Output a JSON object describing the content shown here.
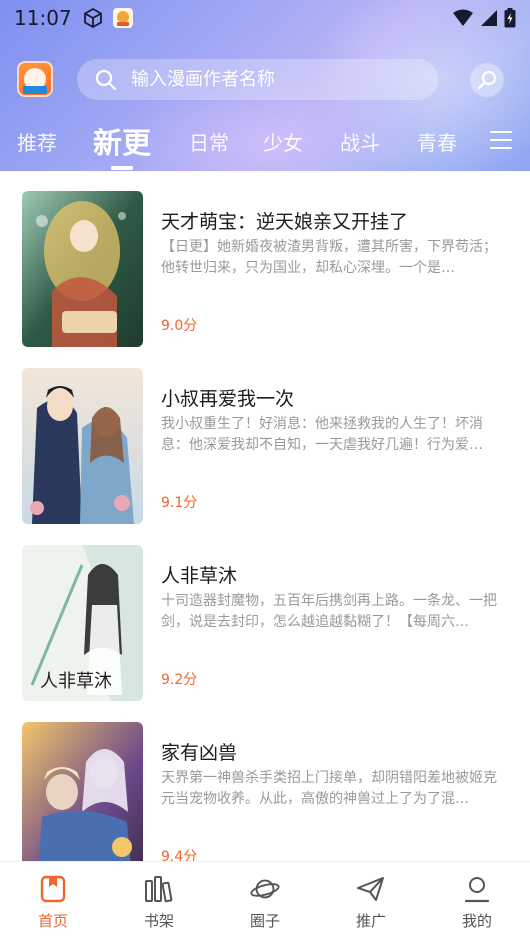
{
  "status_bar": {
    "time": "11:07"
  },
  "search": {
    "placeholder": "输入漫画作者名称"
  },
  "tabs": [
    {
      "label": "推荐",
      "active": false
    },
    {
      "label": "新更",
      "active": true
    },
    {
      "label": "日常",
      "active": false
    },
    {
      "label": "少女",
      "active": false
    },
    {
      "label": "战斗",
      "active": false
    },
    {
      "label": "青春",
      "active": false
    }
  ],
  "comics": [
    {
      "title": "天才萌宝：逆天娘亲又开挂了",
      "description": "【日更】她新婚夜被渣男背叛，遭其所害，下界苟活；他转世归来，只为国业，却私心深埋。一个是…",
      "rating": "9.0分",
      "cover_palette": [
        "#2f5a46",
        "#e6c46a",
        "#9fcbb5",
        "#c2573e"
      ]
    },
    {
      "title": "小叔再爱我一次",
      "description": "我小叔重生了！好消息：他来拯救我的人生了！坏消息：他深爱我却不自知，一天虐我好几遍！行为爱…",
      "rating": "9.1分",
      "cover_palette": [
        "#2b3a5c",
        "#d9c6a8",
        "#7ea7c9",
        "#f2e6d8"
      ]
    },
    {
      "title": "人非草沐",
      "description": "十司造器封魔物，五百年后携剑再上路。一条龙、一把剑，说是去封印，怎么越追越黏糊了！【每周六…",
      "rating": "9.2分",
      "cover_palette": [
        "#eef3ee",
        "#3c3c3c",
        "#7fb89a",
        "#d7e6de"
      ]
    },
    {
      "title": "家有凶兽",
      "description": "天界第一神兽杀手类招上门接单，却阴错阳差地被姬克元当宠物收养。从此，高傲的神兽过上了为了混…",
      "rating": "9.4分",
      "cover_palette": [
        "#3b2b4a",
        "#e8d4c2",
        "#6d4a8a",
        "#f3c66b"
      ]
    }
  ],
  "bottom_nav": [
    {
      "label": "首页",
      "icon": "home-book-icon",
      "active": true
    },
    {
      "label": "书架",
      "icon": "bookshelf-icon",
      "active": false
    },
    {
      "label": "圈子",
      "icon": "planet-icon",
      "active": false
    },
    {
      "label": "推广",
      "icon": "paper-plane-icon",
      "active": false
    },
    {
      "label": "我的",
      "icon": "user-icon",
      "active": false
    }
  ],
  "colors": {
    "accent": "#f0652c",
    "header_start": "#7d8ff0",
    "header_end": "#b9b4f6"
  }
}
